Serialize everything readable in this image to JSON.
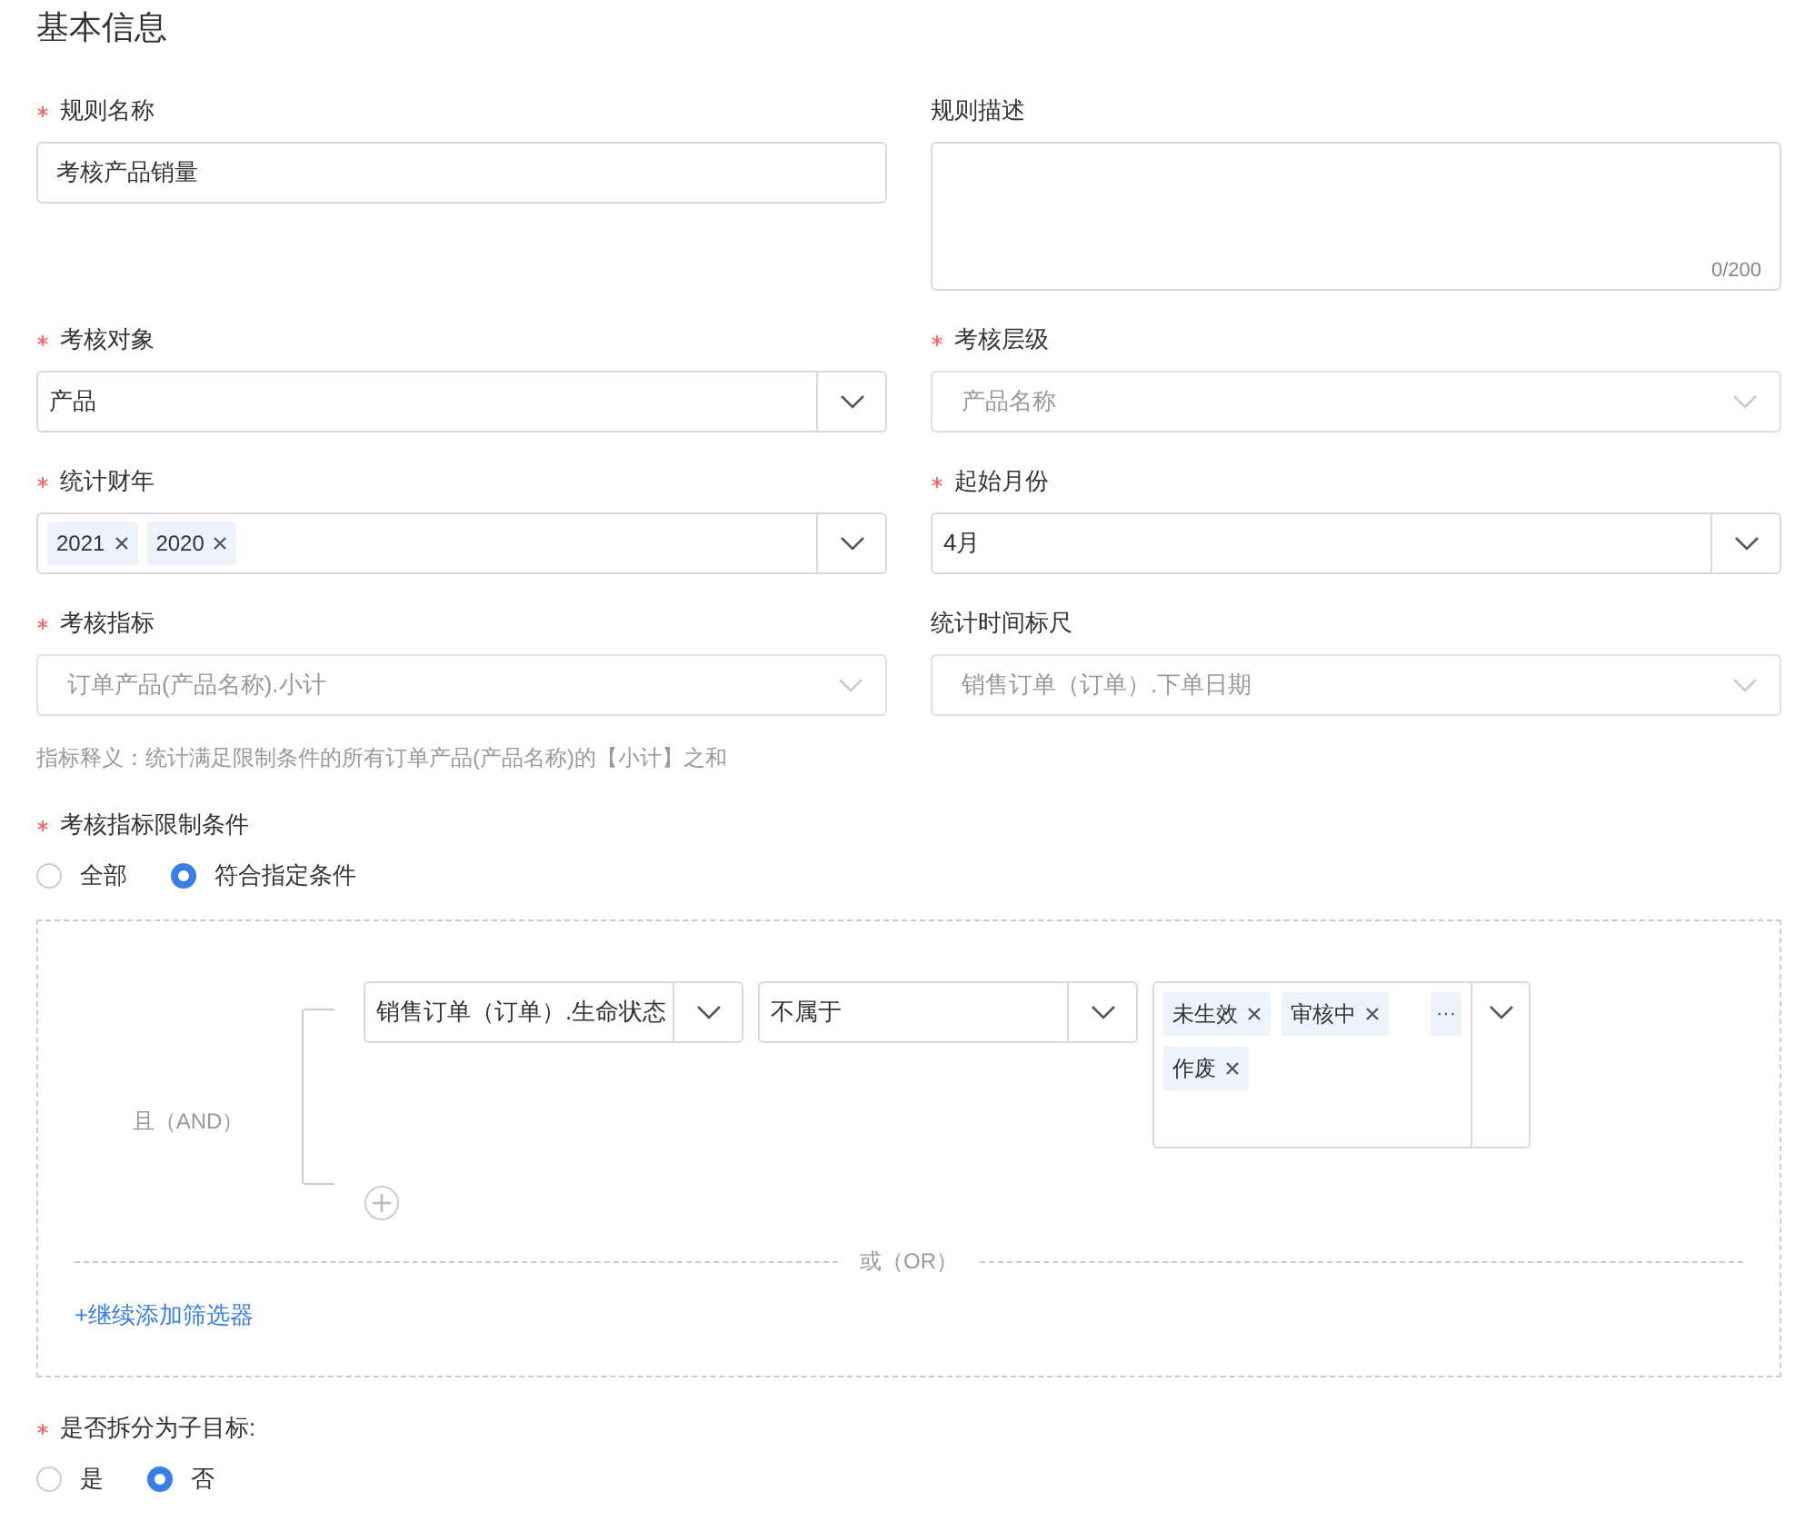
{
  "title": "基本信息",
  "fields": [
    {
      "label": "规则名称",
      "required": true,
      "kind": "input",
      "value": "考核产品销量"
    },
    {
      "label": "规则描述",
      "required": false,
      "kind": "textarea",
      "counter": "0/200"
    },
    {
      "label": "考核对象",
      "required": true,
      "kind": "select",
      "value": "产品",
      "disabled": false
    },
    {
      "label": "考核层级",
      "required": true,
      "kind": "select",
      "value": "产品名称",
      "disabled": true
    },
    {
      "label": "统计财年",
      "required": true,
      "kind": "tags",
      "tags": [
        "2021",
        "2020"
      ]
    },
    {
      "label": "起始月份",
      "required": true,
      "kind": "select",
      "value": "4月",
      "disabled": false
    },
    {
      "label": "考核指标",
      "required": true,
      "kind": "select",
      "value": "订单产品(产品名称).小计",
      "disabled": true
    },
    {
      "label": "统计时间标尺",
      "required": false,
      "kind": "select",
      "value": "销售订单（订单）.下单日期",
      "disabled": true
    }
  ],
  "hint": "指标释义：统计满足限制条件的所有订单产品(产品名称)的【小计】之和",
  "limit": {
    "label": "考核指标限制条件",
    "required": true,
    "options": [
      {
        "label": "全部",
        "selected": false
      },
      {
        "label": "符合指定条件",
        "selected": true
      }
    ]
  },
  "conditions": {
    "group_label": "且（AND）",
    "rows": [
      {
        "field": "销售订单（订单）.生命状态",
        "operator": "不属于",
        "values": [
          "未生效",
          "审核中",
          "作废"
        ],
        "more": "···"
      }
    ],
    "or_label": "或（OR）",
    "add_link": "+继续添加筛选器"
  },
  "split": {
    "label": "是否拆分为子目标:",
    "required": true,
    "options": [
      {
        "label": "是",
        "selected": false
      },
      {
        "label": "否",
        "selected": true
      }
    ]
  }
}
